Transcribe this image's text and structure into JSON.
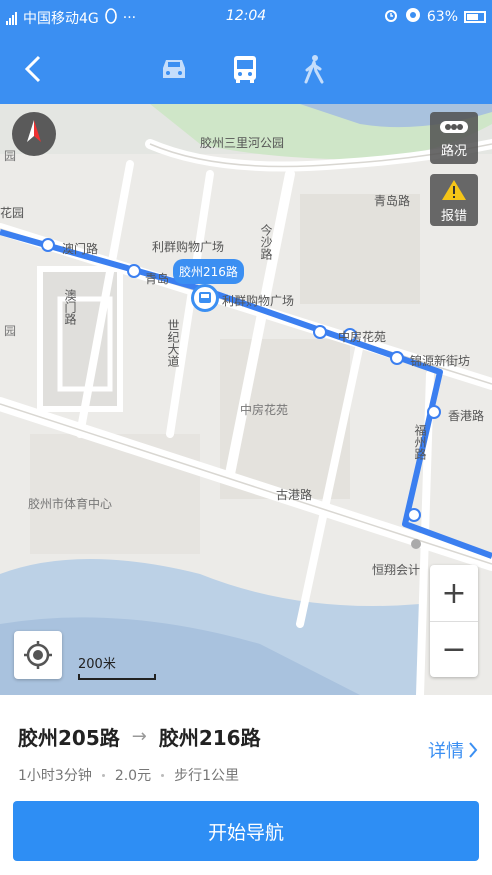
{
  "status_bar": {
    "network": "4G",
    "carrier": "中国移动4G",
    "extra": "···",
    "time": "12:04",
    "battery": "63%"
  },
  "nav": {
    "back_icon": "chevron-left-icon",
    "modes": [
      {
        "name": "car",
        "icon": "car-icon"
      },
      {
        "name": "bus",
        "icon": "bus-icon",
        "selected": true
      },
      {
        "name": "walk",
        "icon": "walk-icon"
      }
    ]
  },
  "map": {
    "traffic_label": "路况",
    "report_label": "报错",
    "bus_bubble": "胶州216路",
    "scale_label": "200米",
    "places": {
      "park": "胶州三里河公园",
      "mall1": "利群购物广场",
      "mall2": "利群购物广场",
      "road_qingdao": "青岛路",
      "road_qinglu": "青岛",
      "road_jinsha": "今沙路",
      "road_ao": "澳门路",
      "road_liuzhou": "澳门路",
      "road_shi": "世纪大道",
      "road_fu": "福州路",
      "road_xiang": "香港路",
      "road_gu": "古港路",
      "huayuan": "中房花苑",
      "huayuan2": "中房花苑",
      "jinyuan": "锦源新街坊",
      "gym": "胶州市体育中心",
      "hengtai": "恒翔会计",
      "garden_left": "花园",
      "garden_top": "园",
      "sports": "园"
    },
    "colors": {
      "route": "#3b7ff0",
      "accent": "#3b8ff2",
      "water": "#a9c2de",
      "park": "#cfe6c8"
    }
  },
  "panel": {
    "from_route": "胶州205路",
    "to_route": "胶州216路",
    "details_label": "详情",
    "duration": "1小时3分钟",
    "fare": "2.0元",
    "walk": "步行1公里",
    "start_button": "开始导航"
  }
}
